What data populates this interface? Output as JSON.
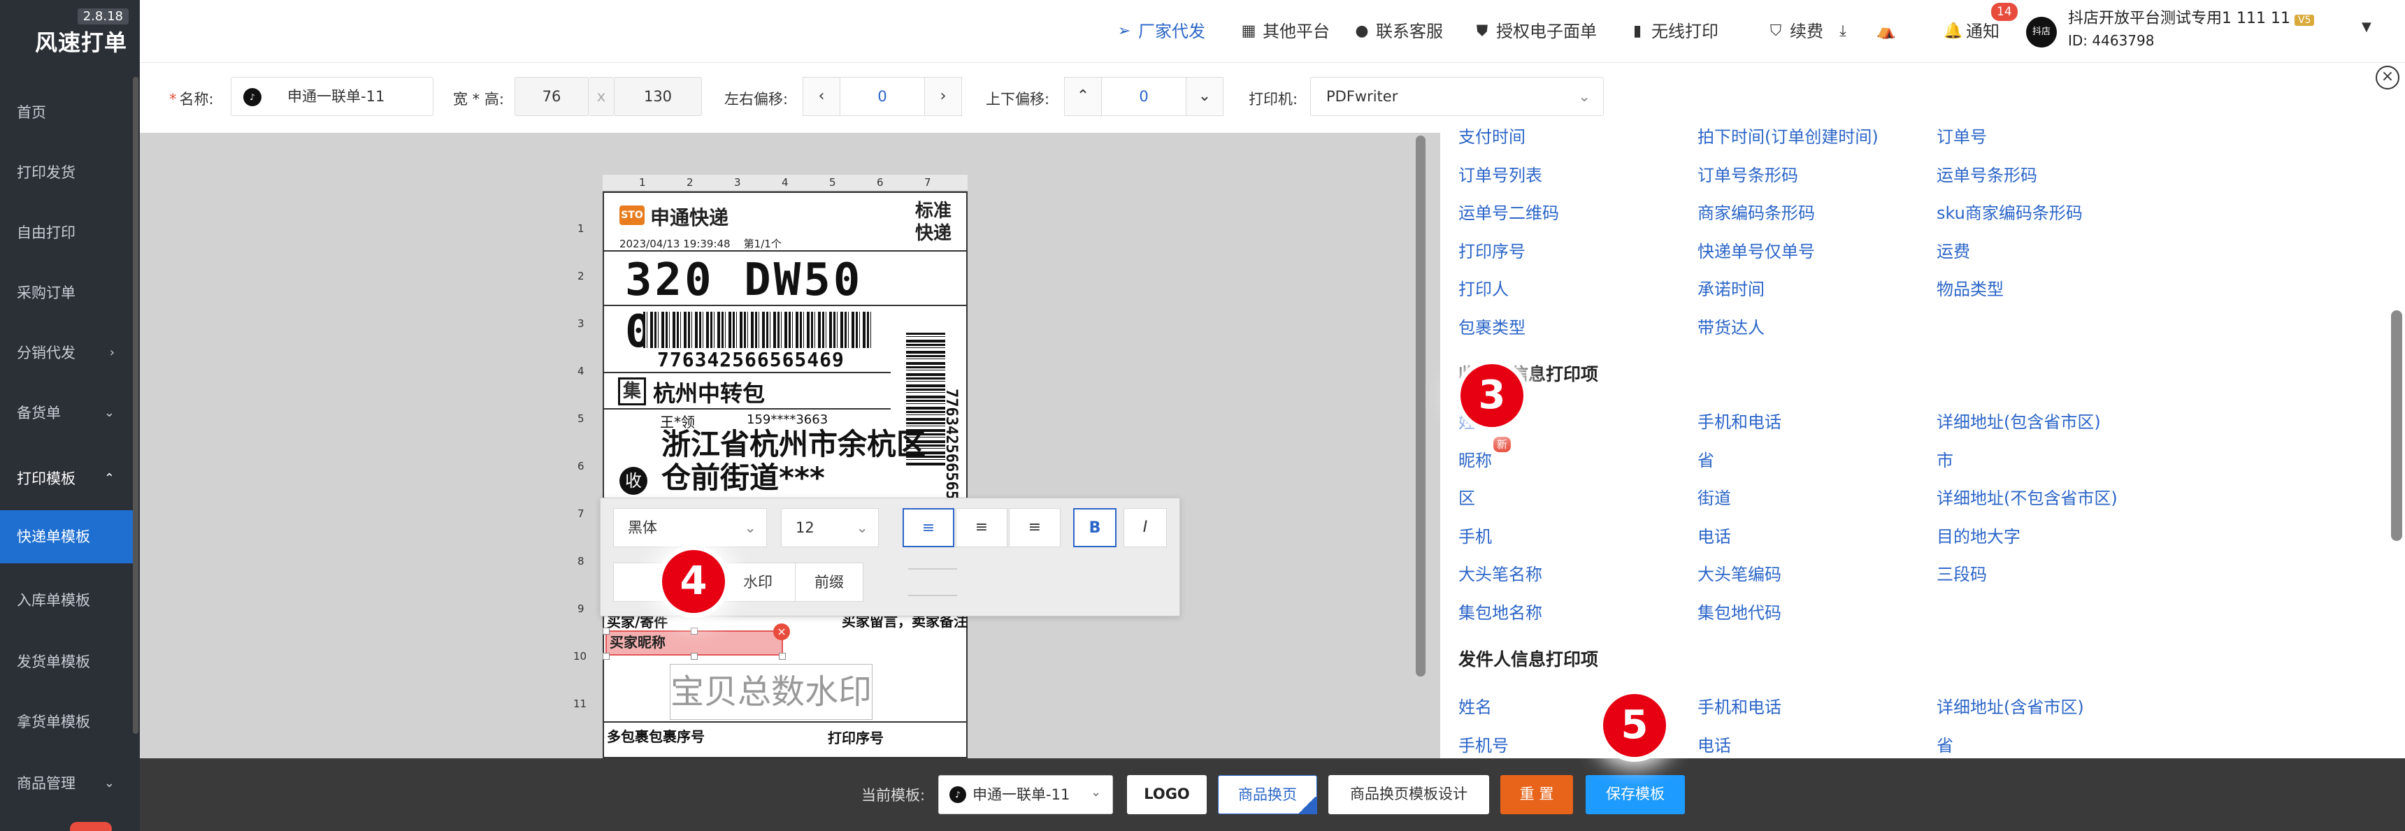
{
  "app": {
    "title": "风速打单",
    "version": "2.8.18"
  },
  "sidebar": {
    "items": [
      {
        "label": "首页"
      },
      {
        "label": "打印发货"
      },
      {
        "label": "自由打印"
      },
      {
        "label": "采购订单"
      },
      {
        "label": "分销代发",
        "arrow": "›"
      },
      {
        "label": "备货单",
        "arrow": "⌄"
      },
      {
        "label": "打印模板",
        "arrow": "⌃"
      },
      {
        "label": "快递单模板"
      },
      {
        "label": "入库单模板"
      },
      {
        "label": "发货单模板"
      },
      {
        "label": "拿货单模板"
      },
      {
        "label": "商品管理",
        "arrow": "⌄"
      }
    ]
  },
  "topbar": {
    "items": [
      "厂家代发",
      "其他平台",
      "联系客服",
      "授权电子面单",
      "无线打印",
      "续费",
      "通知"
    ],
    "notify_count": "14",
    "shop_name": "抖店开放平台测试专用1 111 11",
    "shop_level": "V5",
    "shop_id": "ID: 4463798",
    "avatar_text": "抖店"
  },
  "settings": {
    "name_label": "名称:",
    "name_value": "申通一联单-11",
    "size_label": "宽 * 高:",
    "width": "76",
    "x_sep": "x",
    "height": "130",
    "lr_label": "左右偏移:",
    "lr_value": "0",
    "ud_label": "上下偏移:",
    "ud_value": "0",
    "printer_label": "打印机:",
    "printer_value": "PDFwriter"
  },
  "label": {
    "logo": "STO",
    "brand": "申通快递",
    "std": "标准快递",
    "time": "2023/04/13 19:39:48",
    "page": "第1/1个",
    "code": "320 DW50 004",
    "tracking": "776342566565469",
    "tracking_v": "776342566565469",
    "ji": "集",
    "hub": "杭州中转包",
    "receiver": "王*领",
    "phone": "159****3663",
    "address": "浙江省杭州市余杭区仓前街道***",
    "shou": "收",
    "buyer_label": "买家/寄件",
    "buyer_msg": "买家留言，卖家备注",
    "nickname": "买家昵称",
    "watermark": "宝贝总数水印",
    "multi": "多包裹包裹序号",
    "print_seq": "打印序号"
  },
  "ruler": {
    "top": [
      "1",
      "2",
      "3",
      "4",
      "5",
      "6",
      "7"
    ],
    "left": [
      "1",
      "2",
      "3",
      "4",
      "5",
      "6",
      "7",
      "8",
      "9",
      "10",
      "11"
    ]
  },
  "float_toolbar": {
    "font": "黑体",
    "size": "12",
    "btn_auto": "自适应",
    "btn_wm": "水印",
    "btn_prefix": "前缀"
  },
  "right_panel": {
    "rows_top": [
      [
        "支付时间",
        "拍下时间(订单创建时间)",
        "订单号"
      ],
      [
        "订单号列表",
        "订单号条形码",
        "运单号条形码"
      ],
      [
        "运单号二维码",
        "商家编码条形码",
        "sku商家编码条形码"
      ],
      [
        "打印序号",
        "快递单号仅单号",
        "运费"
      ],
      [
        "打印人",
        "承诺时间",
        "物品类型"
      ],
      [
        "包裹类型",
        "带货达人",
        ""
      ]
    ],
    "recv_head": "收件人信息打印项",
    "recv_rows": [
      [
        "姓名",
        "手机和电话",
        "详细地址(包含省市区)"
      ],
      [
        "昵称",
        "省",
        "市"
      ],
      [
        "区",
        "街道",
        "详细地址(不包含省市区)"
      ],
      [
        "手机",
        "电话",
        "目的地大字"
      ],
      [
        "大头笔名称",
        "大头笔编码",
        "三段码"
      ],
      [
        "集包地名称",
        "集包地代码",
        ""
      ]
    ],
    "new_tag": "新",
    "sender_head": "发件人信息打印项",
    "sender_rows": [
      [
        "姓名",
        "手机和电话",
        "详细地址(含省市区)"
      ],
      [
        "手机号",
        "电话",
        "省"
      ]
    ]
  },
  "bottombar": {
    "current_label": "当前模板:",
    "current_value": "申通一联单-11",
    "logo_btn": "LOGO",
    "swap_btn": "商品换页",
    "swap_design_btn": "商品换页模板设计",
    "reset_btn": "重 置",
    "save_btn": "保存模板"
  },
  "steps": [
    "3",
    "4",
    "5"
  ]
}
